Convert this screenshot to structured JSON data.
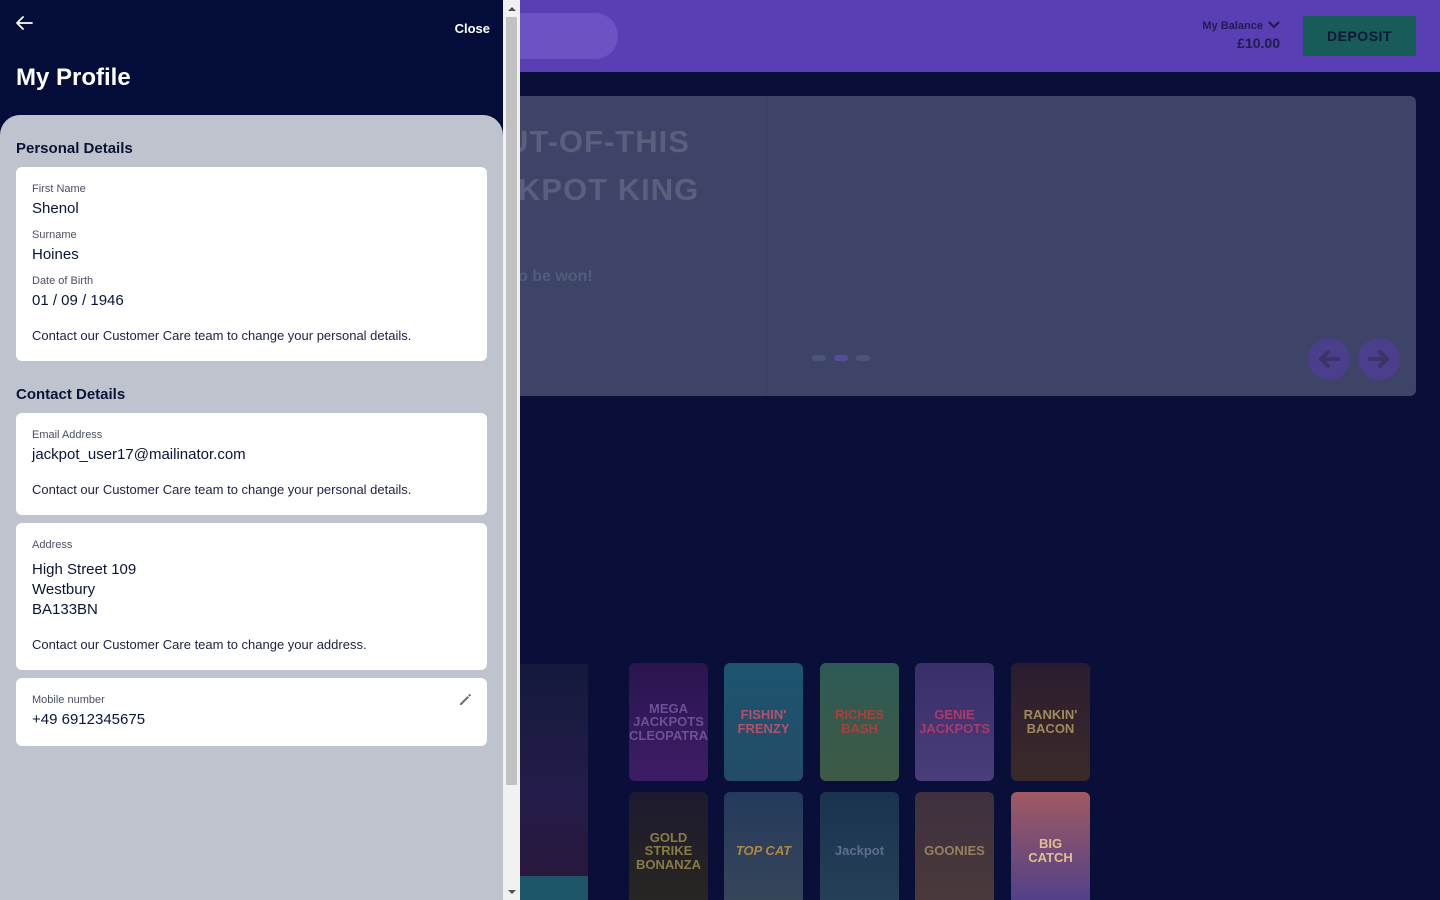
{
  "site": {
    "balance_label": "My Balance",
    "balance_value": "£10.00",
    "deposit_label": "DEPOSIT",
    "hero": {
      "line1": "UT-OF-THIS",
      "line2": "KPOT KING",
      "sub": "o be won!"
    },
    "games": [
      "MEGA JACKPOTS CLEOPATRA",
      "FISHIN' FRENZY",
      "RICHES BASH",
      "GENIE JACKPOTS",
      "RANKIN' BACON",
      "GOLD STRIKE BONANZA",
      "TOP CAT",
      "Jackpot",
      "GOONIES",
      "BIG CATCH"
    ]
  },
  "panel": {
    "close_label": "Close",
    "title": "My Profile",
    "personal": {
      "section_title": "Personal Details",
      "first_name_label": "First Name",
      "first_name": "Shenol",
      "surname_label": "Surname",
      "surname": "Hoines",
      "dob_label": "Date of Birth",
      "dob": "01 / 09 / 1946",
      "note": "Contact our Customer Care team to change your personal details."
    },
    "contact": {
      "section_title": "Contact Details",
      "email_label": "Email Address",
      "email": "jackpot_user17@mailinator.com",
      "email_note": "Contact our Customer Care team to change your personal details.",
      "address_label": "Address",
      "address_line1": "High Street 109",
      "address_line2": "Westbury",
      "address_line3": "BA133BN",
      "address_note": "Contact our Customer Care team to change your address.",
      "mobile_label": "Mobile number",
      "mobile": "+49 6912345675"
    }
  },
  "icons": {
    "back": "arrow-left-icon",
    "edit": "pencil-icon",
    "balance_toggle": "chevron-down-icon"
  }
}
